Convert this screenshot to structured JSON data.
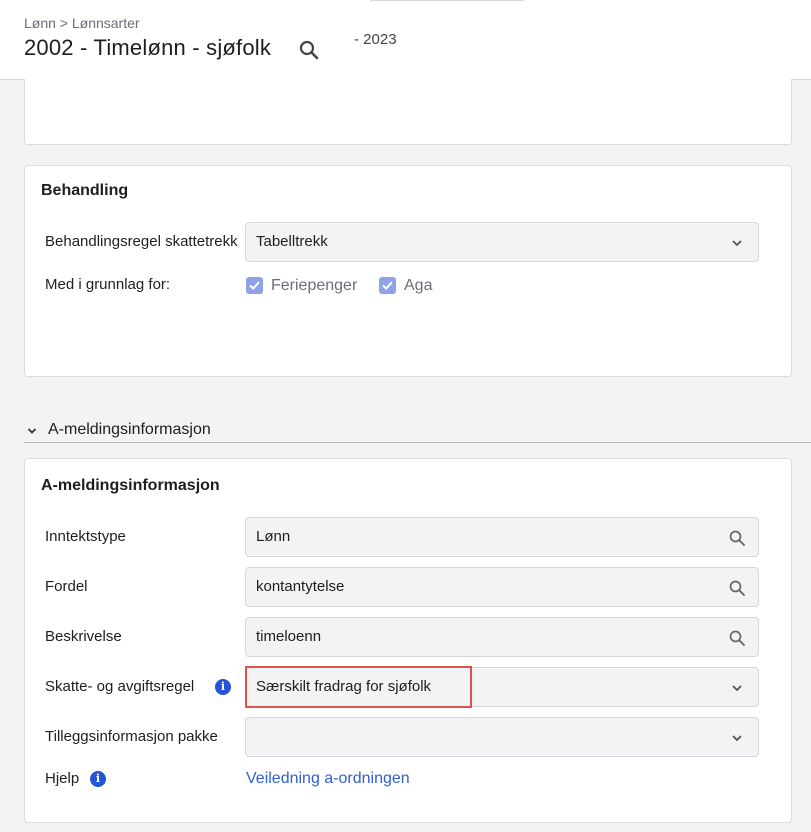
{
  "header": {
    "breadcrumb": "Lønn > Lønnsarter",
    "title": "2002 - Timelønn - sjøfolk",
    "year": "- 2023"
  },
  "behandling": {
    "title": "Behandling",
    "skattetrekk_label": "Behandlingsregel skattetrekk",
    "skattetrekk_value": "Tabelltrekk",
    "grunnlag_label": "Med i grunnlag for:",
    "checkboxes": [
      {
        "label": "Feriepenger",
        "checked": true
      },
      {
        "label": "Aga",
        "checked": true
      }
    ]
  },
  "section": {
    "title": "A-meldingsinformasjon"
  },
  "amelding": {
    "title": "A-meldingsinformasjon",
    "inntektstype_label": "Inntektstype",
    "inntektstype_value": "Lønn",
    "fordel_label": "Fordel",
    "fordel_value": "kontantytelse",
    "beskrivelse_label": "Beskrivelse",
    "beskrivelse_value": "timeloenn",
    "skatteregel_label": "Skatte- og avgiftsregel",
    "skatteregel_value": "Særskilt fradrag for sjøfolk",
    "tillegg_label": "Tilleggsinformasjon pakke",
    "tillegg_value": "",
    "hjelp_label": "Hjelp",
    "hjelp_link": "Veiledning a-ordningen",
    "info_glyph": "i"
  },
  "icons": {
    "search": "search-icon",
    "chevron": "chevron-down-icon",
    "info": "info-icon",
    "check": "check-icon"
  },
  "colors": {
    "accent": "#2f5fd3",
    "checkbox": "#8fa2e6",
    "highlight": "#d9534f",
    "info": "#2455d6"
  }
}
